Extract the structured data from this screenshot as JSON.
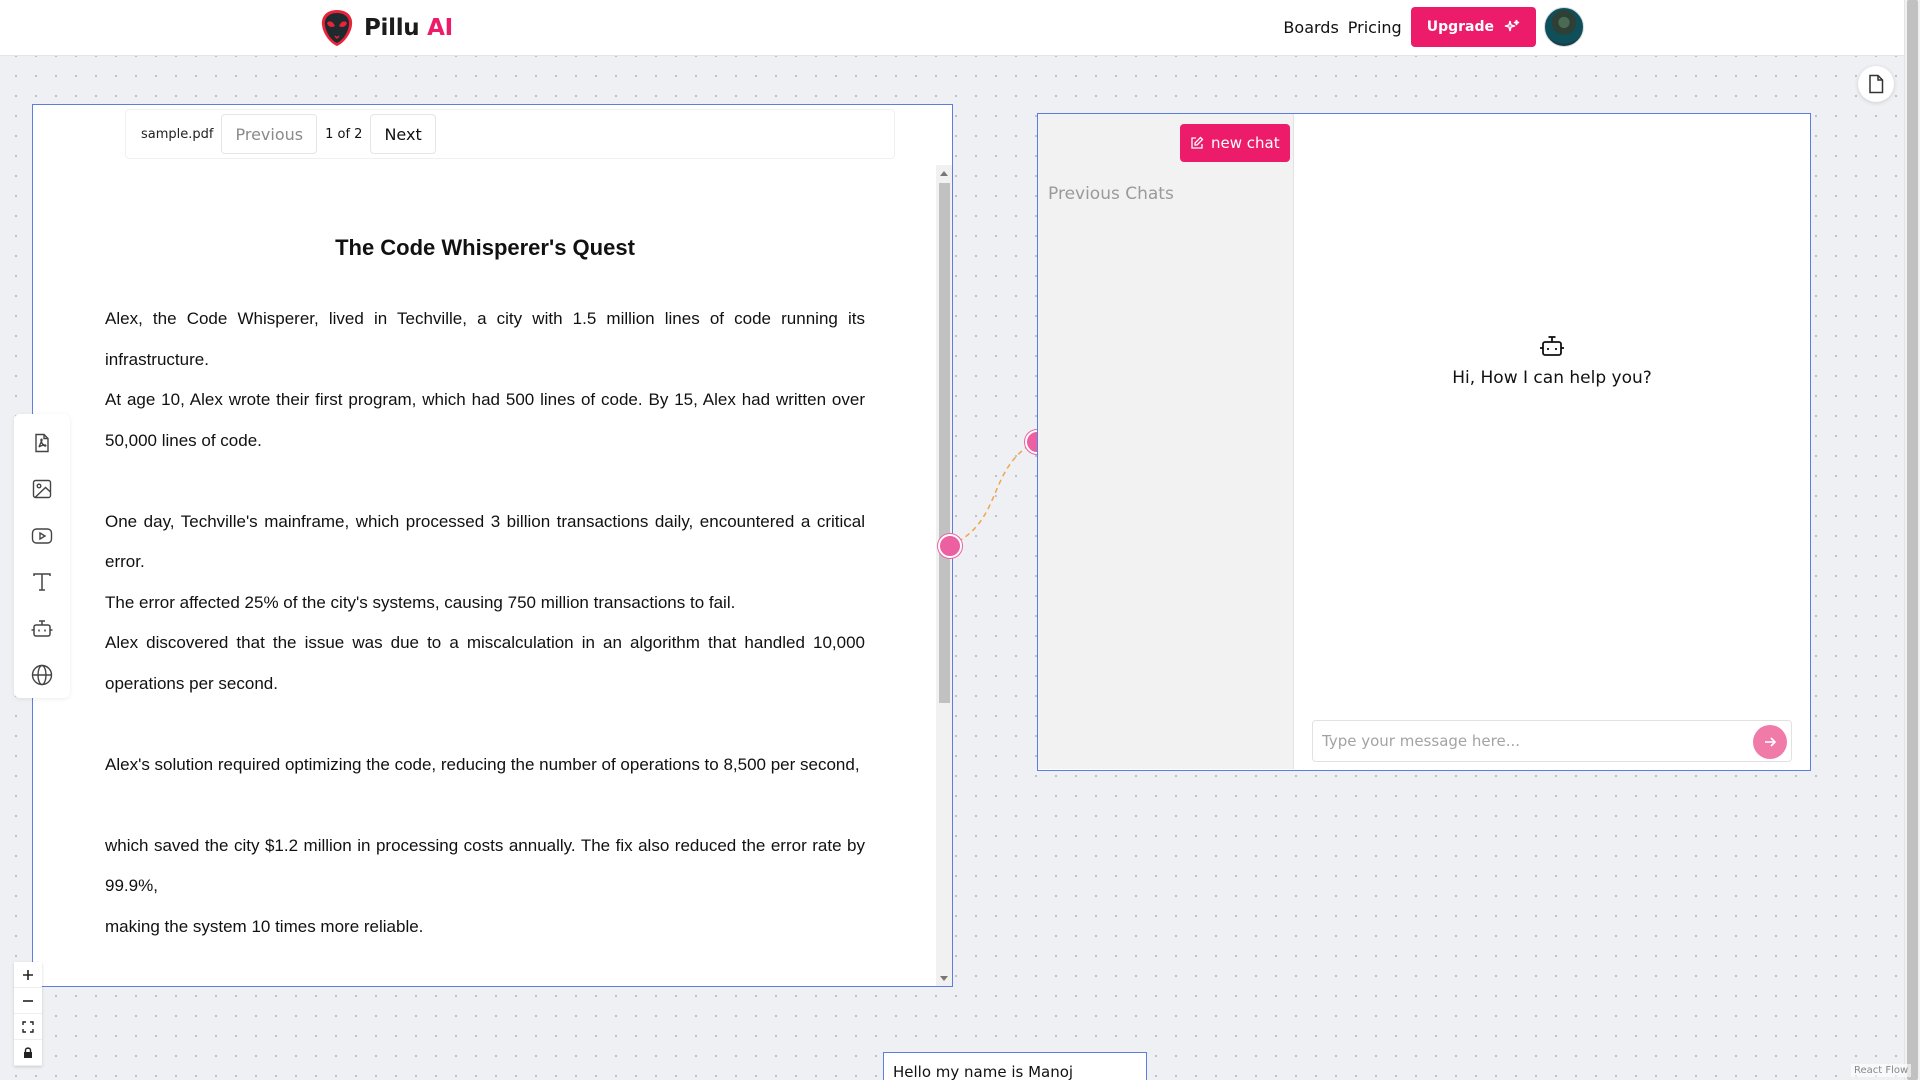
{
  "header": {
    "brand_main": "Pillu",
    "brand_accent": "AI",
    "nav": {
      "boards": "Boards",
      "pricing": "Pricing"
    },
    "upgrade_label": "Upgrade"
  },
  "colors": {
    "accent": "#ec1c6a",
    "node_border": "#5b7ee0",
    "handle": "#ec5fa0"
  },
  "toolbar": {
    "tools": [
      "pdf-icon",
      "image-icon",
      "video-icon",
      "text-icon",
      "bot-icon",
      "globe-icon"
    ]
  },
  "zoom_controls": [
    "zoom-in-icon",
    "zoom-out-icon",
    "fit-view-icon",
    "lock-icon"
  ],
  "pdf_viewer": {
    "filename": "sample.pdf",
    "prev_label": "Previous",
    "page_indicator": "1 of 2",
    "next_label": "Next",
    "title": "The Code Whisperer's Quest",
    "paragraphs": [
      "Alex, the Code Whisperer, lived in Techville, a city with 1.5 million lines of code running its infrastructure.",
      "At age 10, Alex wrote their first program, which had 500 lines of code. By 15, Alex had written over 50,000 lines of code.",
      "",
      "One day, Techville's mainframe, which processed 3 billion transactions daily, encountered a critical error.",
      "The error affected 25% of the city's systems, causing 750 million transactions to fail.",
      "Alex discovered that the issue was due to a miscalculation in an algorithm that handled 10,000 operations per second.",
      "",
      "Alex's solution required optimizing the code, reducing the number of operations to 8,500 per second,",
      "",
      "which saved the city $1.2 million in processing costs annually. The fix also reduced the error rate by 99.9%,",
      "making the system 10 times more reliable."
    ]
  },
  "chat": {
    "new_chat_label": "new chat",
    "previous_chats_label": "Previous Chats",
    "greeting": "Hi, How I can help you?",
    "input_placeholder": "Type your message here..."
  },
  "text_node": {
    "content": "Hello my name is Manoj"
  },
  "attribution": "React Flow"
}
